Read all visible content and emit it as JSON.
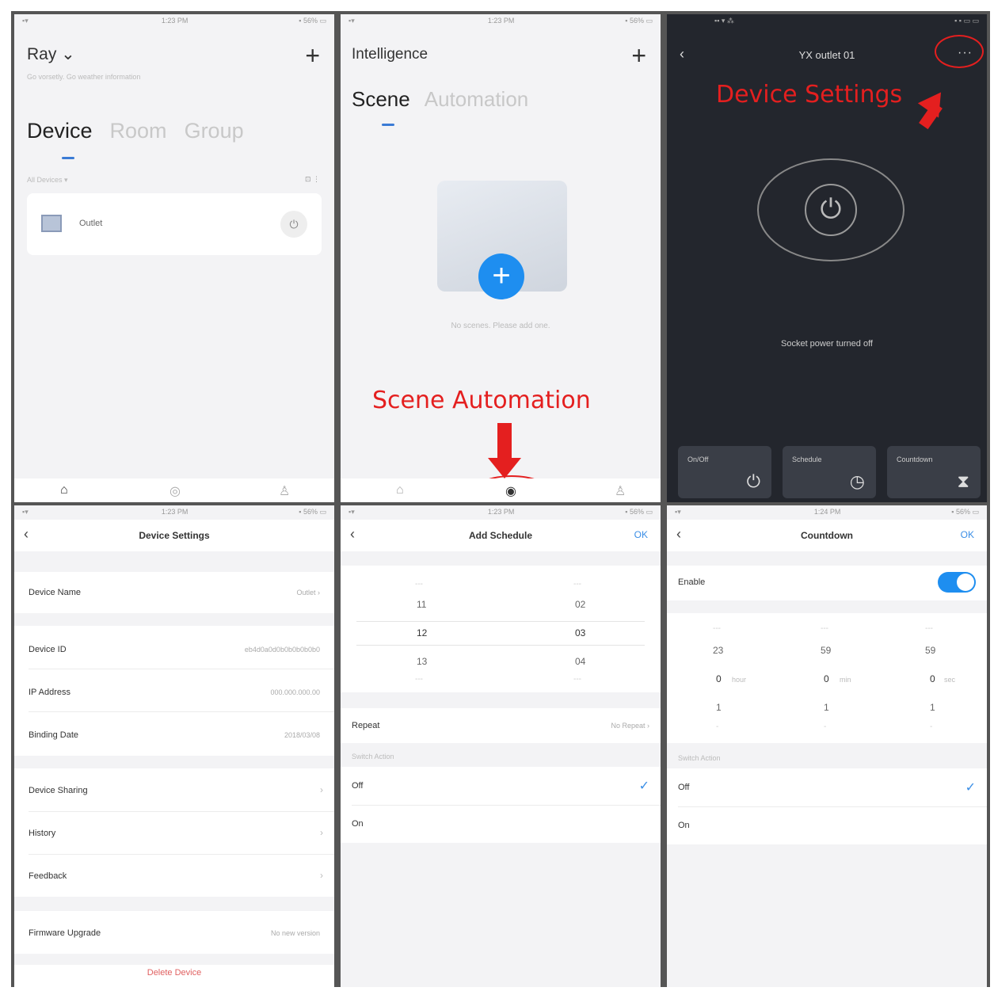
{
  "panel1": {
    "status": {
      "left": "▪▾",
      "center": "1:23 PM",
      "right": "▪ 56% ▭"
    },
    "title": "Ray ⌄",
    "subtitle": "Go vorsetly. Go weather information",
    "add_icon": "plus-icon",
    "tabs": [
      "Device",
      "Room",
      "Group"
    ],
    "meta_left": "All Devices ▾",
    "meta_right": "⊡ ⋮",
    "device": {
      "name": "Outlet",
      "power_icon": "power-icon"
    },
    "nav": [
      "home-icon",
      "intelligence-icon",
      "profile-icon"
    ]
  },
  "panel2": {
    "status": {
      "left": "▪▾",
      "center": "1:23 PM",
      "right": "▪ 56% ▭"
    },
    "title": "Intelligence",
    "tabs": [
      "Scene",
      "Automation"
    ],
    "empty_hint": "No scenes. Please add one.",
    "annotation": "Scene  Automation",
    "fab_label": "+"
  },
  "panel3": {
    "status": {
      "left": "▪▪ ▾ ⁂",
      "right": "▪ ▪ ▭ ▭"
    },
    "title": "YX outlet 01",
    "annotation": "Device Settings",
    "power_glyph": "⏻",
    "status_text": "Socket power turned off",
    "controls": [
      {
        "label": "On/Off",
        "icon": "⏻"
      },
      {
        "label": "Schedule",
        "icon": "◷"
      },
      {
        "label": "Countdown",
        "icon": "⧗"
      }
    ]
  },
  "panel4": {
    "status": {
      "left": "▪▾",
      "center": "1:23 PM",
      "right": "▪ 56% ▭"
    },
    "title": "Device Settings",
    "rows": [
      {
        "label": "Device Name",
        "value": "Outlet ›"
      },
      {
        "label": "Device ID",
        "value": "eb4d0a0d0b0b0b0b0b0"
      },
      {
        "label": "IP Address",
        "value": "000.000.000.00"
      },
      {
        "label": "Binding Date",
        "value": "2018/03/08"
      },
      {
        "label": "Device Sharing",
        "value": "›"
      },
      {
        "label": "History",
        "value": "›"
      },
      {
        "label": "Feedback",
        "value": "›"
      },
      {
        "label": "Firmware Upgrade",
        "value": "No new version"
      }
    ],
    "remove": "Delete Device"
  },
  "panel5": {
    "status": {
      "left": "▪▾",
      "center": "1:23 PM",
      "right": "▪ 56% ▭"
    },
    "title": "Add Schedule",
    "ok": "OK",
    "hours": [
      "---",
      "11",
      "12",
      "13",
      "---"
    ],
    "minutes": [
      "---",
      "02",
      "03",
      "04",
      "---"
    ],
    "repeat_label": "Repeat",
    "repeat_value": "No Repeat ›",
    "caption": "Switch Action",
    "options": [
      "Off",
      "On"
    ]
  },
  "panel6": {
    "status": {
      "left": "▪▾",
      "center": "1:24 PM",
      "right": "▪ 56% ▭"
    },
    "title": "Countdown",
    "ok": "OK",
    "enable_label": "Enable",
    "col1": [
      "---",
      "23",
      "0",
      "1",
      "-"
    ],
    "col2": [
      "---",
      "59",
      "0",
      "1",
      "-"
    ],
    "col3": [
      "---",
      "59",
      "0",
      "1",
      "-"
    ],
    "units": [
      "hour",
      "min",
      "sec"
    ],
    "caption": "Switch Action",
    "options": [
      "Off",
      "On"
    ]
  }
}
